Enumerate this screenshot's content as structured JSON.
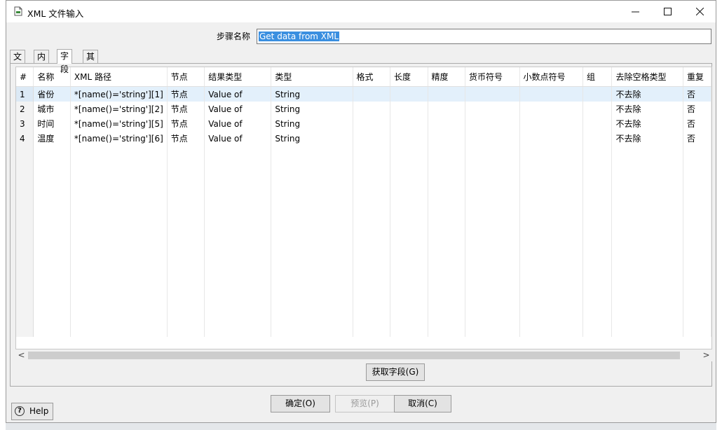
{
  "window": {
    "title": "XML 文件输入"
  },
  "step": {
    "label": "步骤名称",
    "value": "Get data from XML"
  },
  "tabs": [
    {
      "label": "文件",
      "active": false
    },
    {
      "label": "内容",
      "active": false
    },
    {
      "label": "字段",
      "active": true
    },
    {
      "label": "其他输出字段",
      "active": false
    }
  ],
  "grid": {
    "columns": [
      "#",
      "名称",
      "XML 路径",
      "节点",
      "结果类型",
      "类型",
      "格式",
      "长度",
      "精度",
      "货币符号",
      "小数点符号",
      "组",
      "去除空格类型",
      "重复"
    ],
    "rows": [
      [
        "1",
        "省份",
        "*[name()='string'][1]",
        "节点",
        "Value of",
        "String",
        "",
        "",
        "",
        "",
        "",
        "",
        "不去除",
        "否"
      ],
      [
        "2",
        "城市",
        "*[name()='string'][2]",
        "节点",
        "Value of",
        "String",
        "",
        "",
        "",
        "",
        "",
        "",
        "不去除",
        "否"
      ],
      [
        "3",
        "时间",
        "*[name()='string'][5]",
        "节点",
        "Value of",
        "String",
        "",
        "",
        "",
        "",
        "",
        "",
        "不去除",
        "否"
      ],
      [
        "4",
        "温度",
        "*[name()='string'][6]",
        "节点",
        "Value of",
        "String",
        "",
        "",
        "",
        "",
        "",
        "",
        "不去除",
        "否"
      ]
    ],
    "selected_row": 0
  },
  "buttons": {
    "get_fields": "获取字段(G)",
    "ok": "确定(O)",
    "preview": "预览(P)",
    "cancel": "取消(C)",
    "help": "Help"
  }
}
